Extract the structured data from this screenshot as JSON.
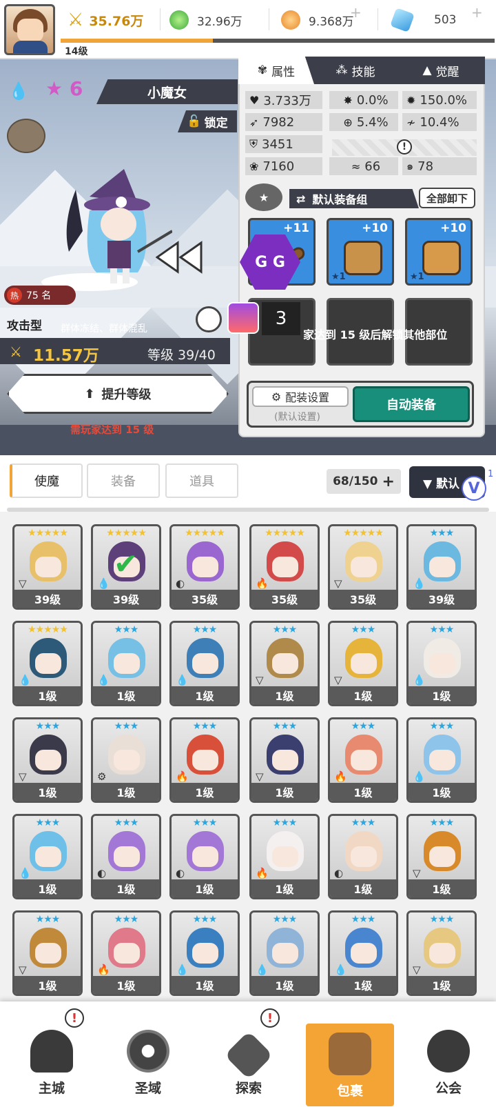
{
  "topbar": {
    "power": "35.76万",
    "green_currency": "32.96万",
    "gold_currency": "9.368万",
    "gem_currency": "503",
    "player_level": "14级",
    "level_progress": 0.35
  },
  "hero": {
    "star_count": "6",
    "name": "小魔女",
    "lock_label": "锁定",
    "hot_label": "热",
    "hot_rank": "75 名",
    "type": "攻击型",
    "skills": "群体冻结、群体混乱",
    "power": "11.57万",
    "level": "等级 39/40",
    "upgrade_label": "提升等级",
    "upgrade_req": "需玩家达到 15 级"
  },
  "panel": {
    "tabs": [
      "属性",
      "技能",
      "觉醒"
    ],
    "stats": {
      "hp": "3.733万",
      "crit": "0.0%",
      "crit_dmg": "150.0%",
      "atk": "7982",
      "hit": "5.4%",
      "dodge": "10.4%",
      "def": "3451",
      "speed": "7160",
      "stat_a": "66",
      "stat_b": "78"
    },
    "equip_group": "默认装备组",
    "unequip_all": "全部卸下",
    "gear": [
      {
        "level": "+11",
        "stars": "★1"
      },
      {
        "level": "+10",
        "stars": "★1"
      },
      {
        "level": "+10",
        "stars": "★1"
      }
    ],
    "unlock_msg": "家达到 15 级后解锁其他部位",
    "overlay_gg": "G G",
    "overlay_count": "3",
    "config_label": "配装设置",
    "config_sub": "(默认设置)",
    "auto_equip": "自动装备"
  },
  "inventory": {
    "tabs": [
      "使魔",
      "装备",
      "道具"
    ],
    "count": "68/150",
    "add": "+",
    "sort_label": "▼ 默认",
    "sup": "1",
    "cards": [
      {
        "stars": "★★★★★",
        "gold": true,
        "level": "39级",
        "color": "#e8c06a",
        "el": "▽"
      },
      {
        "stars": "★★★★★",
        "gold": true,
        "level": "39级",
        "color": "#5d3f7a",
        "el": "💧",
        "check": true
      },
      {
        "stars": "★★★★★",
        "gold": true,
        "level": "35级",
        "color": "#9a66cf",
        "el": "◐"
      },
      {
        "stars": "★★★★★",
        "gold": true,
        "level": "35级",
        "color": "#d24a4a",
        "el": "🔥"
      },
      {
        "stars": "★★★★★",
        "gold": true,
        "level": "35级",
        "color": "#f0d290",
        "el": "▽"
      },
      {
        "stars": "★★★",
        "gold": false,
        "level": "39级",
        "color": "#6bb8e0",
        "el": "💧"
      },
      {
        "stars": "★★★★★",
        "gold": true,
        "level": "1级",
        "color": "#2d5a78",
        "el": "💧"
      },
      {
        "stars": "★★★",
        "gold": false,
        "level": "1级",
        "color": "#76c0e6",
        "el": "💧"
      },
      {
        "stars": "★★★",
        "gold": false,
        "level": "1级",
        "color": "#3f7fb8",
        "el": "💧"
      },
      {
        "stars": "★★★",
        "gold": false,
        "level": "1级",
        "color": "#b08a4a",
        "el": "▽"
      },
      {
        "stars": "★★★",
        "gold": false,
        "level": "1级",
        "color": "#e6b43a",
        "el": "▽"
      },
      {
        "stars": "★★★",
        "gold": false,
        "level": "1级",
        "color": "#f0ebe4",
        "el": "💧"
      },
      {
        "stars": "★★★",
        "gold": false,
        "level": "1级",
        "color": "#3a3a4a",
        "el": "▽"
      },
      {
        "stars": "★★★",
        "gold": false,
        "level": "1级",
        "color": "#eadfd6",
        "el": "⚙"
      },
      {
        "stars": "★★★",
        "gold": false,
        "level": "1级",
        "color": "#d8503a",
        "el": "🔥"
      },
      {
        "stars": "★★★",
        "gold": false,
        "level": "1级",
        "color": "#3a3f70",
        "el": "▽"
      },
      {
        "stars": "★★★",
        "gold": false,
        "level": "1级",
        "color": "#e88a70",
        "el": "🔥"
      },
      {
        "stars": "★★★",
        "gold": false,
        "level": "1级",
        "color": "#8fc4ea",
        "el": "💧"
      },
      {
        "stars": "★★★",
        "gold": false,
        "level": "1级",
        "color": "#6ec0e8",
        "el": "💧"
      },
      {
        "stars": "★★★",
        "gold": false,
        "level": "1级",
        "color": "#a377d6",
        "el": "◐"
      },
      {
        "stars": "★★★",
        "gold": false,
        "level": "1级",
        "color": "#a377d6",
        "el": "◐"
      },
      {
        "stars": "★★★",
        "gold": false,
        "level": "1级",
        "color": "#f4f0f0",
        "el": "🔥"
      },
      {
        "stars": "★★★",
        "gold": false,
        "level": "1级",
        "color": "#f0d8c4",
        "el": "◐"
      },
      {
        "stars": "★★★",
        "gold": false,
        "level": "1级",
        "color": "#d88a2a",
        "el": "▽"
      },
      {
        "stars": "★★★",
        "gold": false,
        "level": "1级",
        "color": "#c08a3a",
        "el": "▽"
      },
      {
        "stars": "★★★",
        "gold": false,
        "level": "1级",
        "color": "#e07a8a",
        "el": "🔥"
      },
      {
        "stars": "★★★",
        "gold": false,
        "level": "1级",
        "color": "#3a7fc0",
        "el": "💧"
      },
      {
        "stars": "★★★",
        "gold": false,
        "level": "1级",
        "color": "#8fb4d8",
        "el": "💧"
      },
      {
        "stars": "★★★",
        "gold": false,
        "level": "1级",
        "color": "#4a86d0",
        "el": "💧"
      },
      {
        "stars": "★★★",
        "gold": false,
        "level": "1级",
        "color": "#e6c880",
        "el": "▽"
      },
      {
        "stars": "★★★",
        "gold": false,
        "level": "",
        "color": "#cfcfcf",
        "el": ""
      },
      {
        "stars": "★★★",
        "gold": false,
        "level": "",
        "color": "#cfcfcf",
        "el": ""
      },
      {
        "stars": "★★★",
        "gold": false,
        "level": "",
        "color": "#cfcfcf",
        "el": ""
      },
      {
        "stars": "★★★",
        "gold": false,
        "level": "",
        "color": "#cfcfcf",
        "el": ""
      },
      {
        "stars": "★★★",
        "gold": false,
        "level": "",
        "color": "#cfcfcf",
        "el": ""
      },
      {
        "stars": "",
        "gold": false,
        "level": "",
        "color": "#cfcfcf",
        "el": ""
      }
    ]
  },
  "nav": {
    "items": [
      "主城",
      "圣域",
      "探索",
      "包裹",
      "公会"
    ],
    "bang": "!"
  }
}
